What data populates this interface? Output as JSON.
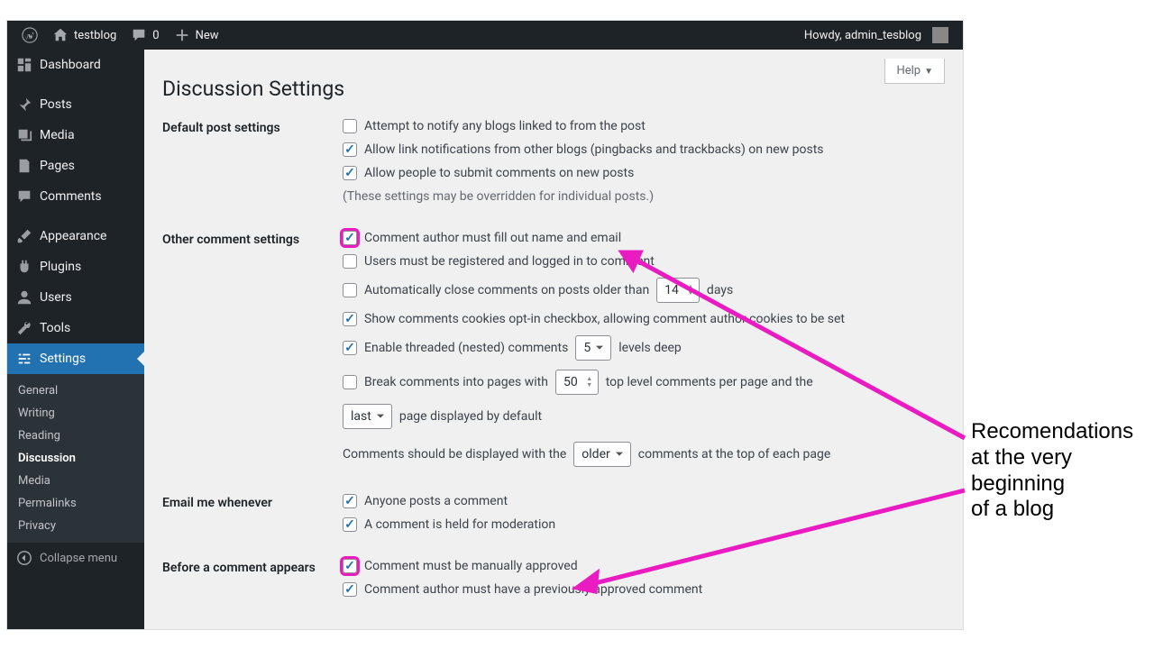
{
  "adminbar": {
    "site_name": "testblog",
    "comment_count": "0",
    "new_label": "New",
    "greeting": "Howdy, admin_tesblog"
  },
  "sidebar": {
    "dashboard": "Dashboard",
    "posts": "Posts",
    "media": "Media",
    "pages": "Pages",
    "comments": "Comments",
    "appearance": "Appearance",
    "plugins": "Plugins",
    "users": "Users",
    "tools": "Tools",
    "settings": "Settings",
    "collapse": "Collapse menu",
    "sub": {
      "general": "General",
      "writing": "Writing",
      "reading": "Reading",
      "discussion": "Discussion",
      "media": "Media",
      "permalinks": "Permalinks",
      "privacy": "Privacy"
    }
  },
  "page": {
    "title": "Discussion Settings",
    "help": "Help"
  },
  "sections": {
    "default_post": {
      "heading": "Default post settings",
      "opt1": "Attempt to notify any blogs linked to from the post",
      "opt2": "Allow link notifications from other blogs (pingbacks and trackbacks) on new posts",
      "opt3": "Allow people to submit comments on new posts",
      "note": "(These settings may be overridden for individual posts.)"
    },
    "other": {
      "heading": "Other comment settings",
      "opt1": "Comment author must fill out name and email",
      "opt2": "Users must be registered and logged in to comment",
      "opt3a": "Automatically close comments on posts older than",
      "opt3_val": "14",
      "opt3b": "days",
      "opt4": "Show comments cookies opt-in checkbox, allowing comment author cookies to be set",
      "opt5a": "Enable threaded (nested) comments",
      "opt5_val": "5",
      "opt5b": "levels deep",
      "opt6a": "Break comments into pages with",
      "opt6_val": "50",
      "opt6b": "top level comments per page and the",
      "opt6_sel": "last",
      "opt6c": "page displayed by default",
      "opt7a": "Comments should be displayed with the",
      "opt7_sel": "older",
      "opt7b": "comments at the top of each page"
    },
    "email": {
      "heading": "Email me whenever",
      "opt1": "Anyone posts a comment",
      "opt2": "A comment is held for moderation"
    },
    "before": {
      "heading": "Before a comment appears",
      "opt1": "Comment must be manually approved",
      "opt2": "Comment author must have a previously approved comment"
    }
  },
  "annotation": {
    "line1": "Recomendations",
    "line2": "at the very",
    "line3": "beginning",
    "line4": "of a blog"
  }
}
